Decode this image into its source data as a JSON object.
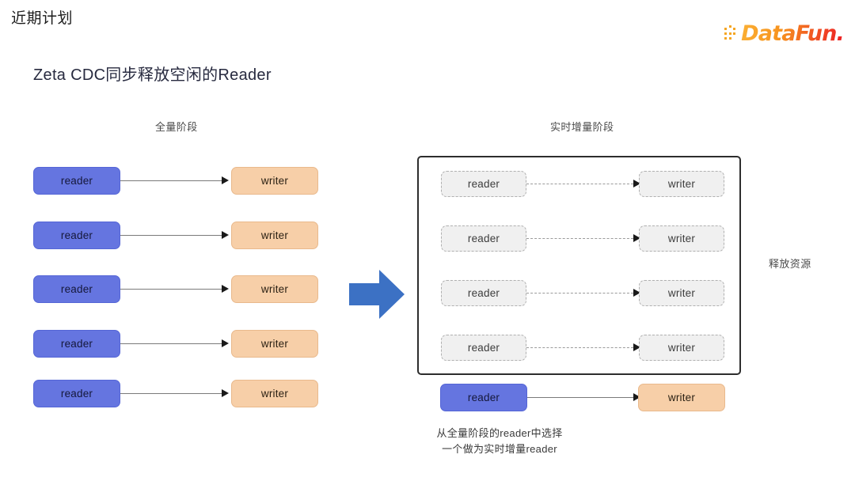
{
  "header": {
    "title": "近期计划",
    "brand_name": "DataFun.",
    "brand_gradient_from": "#fbb034",
    "brand_gradient_to": "#ed1c24"
  },
  "section": {
    "title": "Zeta CDC同步释放空闲的Reader"
  },
  "labels": {
    "left_stage": "全量阶段",
    "right_stage": "实时增量阶段",
    "side_note": "释放资源"
  },
  "colors": {
    "reader_active": "#6575e0",
    "writer_active": "#f7cfa8",
    "idle_fill": "#f0f0f0",
    "idle_border": "#b0b0b0",
    "group_border": "#2d2d2d",
    "big_arrow": "#3c71c4"
  },
  "left_panel": {
    "rows": [
      {
        "reader": "reader",
        "writer": "writer"
      },
      {
        "reader": "reader",
        "writer": "writer"
      },
      {
        "reader": "reader",
        "writer": "writer"
      },
      {
        "reader": "reader",
        "writer": "writer"
      },
      {
        "reader": "reader",
        "writer": "writer"
      }
    ]
  },
  "right_panel": {
    "released_rows": [
      {
        "reader": "reader",
        "writer": "writer"
      },
      {
        "reader": "reader",
        "writer": "writer"
      },
      {
        "reader": "reader",
        "writer": "writer"
      },
      {
        "reader": "reader",
        "writer": "writer"
      }
    ],
    "active_row": {
      "reader": "reader",
      "writer": "writer"
    }
  },
  "caption": {
    "line1": "从全量阶段的reader中选择",
    "line2": "一个做为实时增量reader"
  }
}
